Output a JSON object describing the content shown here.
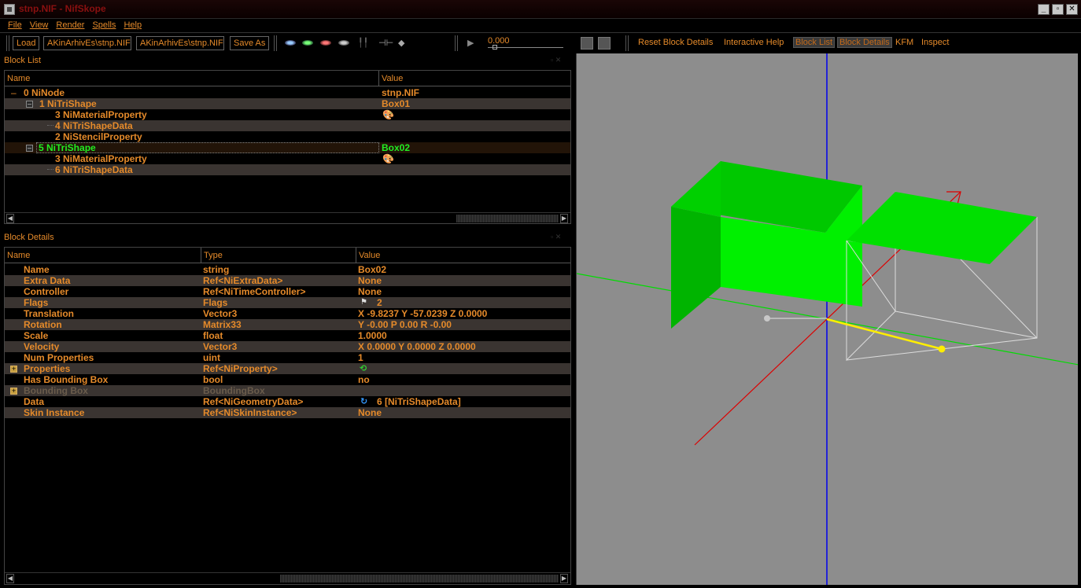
{
  "window": {
    "title": "stnp.NIF - NifSkope",
    "min": "_",
    "max": "▫",
    "close": "✕"
  },
  "menu": [
    "File",
    "View",
    "Render",
    "Spells",
    "Help"
  ],
  "toolbar": {
    "load": "Load",
    "path1": "AKinArhivEs\\stnp.NIF",
    "path2": "AKinArhivEs\\stnp.NIF",
    "save_as": "Save As",
    "time": "0.000",
    "reset_block_details": "Reset Block Details",
    "interactive_help": "Interactive Help",
    "block_list": "Block List",
    "block_details": "Block Details",
    "kfm": "KFM",
    "inspect": "Inspect"
  },
  "block_list": {
    "title": "Block List",
    "col_name": "Name",
    "col_value": "Value",
    "rows": [
      {
        "name": "0 NiNode",
        "value": "stnp.NIF"
      },
      {
        "name": "1 NiTriShape",
        "value": "Box01"
      },
      {
        "name": "3 NiMaterialProperty",
        "value": ""
      },
      {
        "name": "4 NiTriShapeData",
        "value": ""
      },
      {
        "name": "2 NiStencilProperty",
        "value": ""
      },
      {
        "name": "5 NiTriShape",
        "value": "Box02"
      },
      {
        "name": "3 NiMaterialProperty",
        "value": ""
      },
      {
        "name": "6 NiTriShapeData",
        "value": ""
      }
    ]
  },
  "block_details": {
    "title": "Block Details",
    "col_name": "Name",
    "col_type": "Type",
    "col_value": "Value",
    "rows": [
      {
        "name": "Name",
        "type": "string",
        "value": "Box02"
      },
      {
        "name": "Extra Data",
        "type": "Ref<NiExtraData>",
        "value": "None"
      },
      {
        "name": "Controller",
        "type": "Ref<NiTimeController>",
        "value": "None"
      },
      {
        "name": "Flags",
        "type": "Flags",
        "value": "2"
      },
      {
        "name": "Translation",
        "type": "Vector3",
        "value": "X -9.8237 Y -57.0239 Z 0.0000"
      },
      {
        "name": "Rotation",
        "type": "Matrix33",
        "value": "Y -0.00 P 0.00 R -0.00"
      },
      {
        "name": "Scale",
        "type": "float",
        "value": "1.0000"
      },
      {
        "name": "Velocity",
        "type": "Vector3",
        "value": "X 0.0000 Y 0.0000 Z 0.0000"
      },
      {
        "name": "Num Properties",
        "type": "uint",
        "value": "1"
      },
      {
        "name": "Properties",
        "type": "Ref<NiProperty>",
        "value": ""
      },
      {
        "name": "Has Bounding Box",
        "type": "bool",
        "value": "no"
      },
      {
        "name": "Bounding Box",
        "type": "BoundingBox",
        "value": ""
      },
      {
        "name": "Data",
        "type": "Ref<NiGeometryData>",
        "value": "6 [NiTriShapeData]"
      },
      {
        "name": "Skin Instance",
        "type": "Ref<NiSkinInstance>",
        "value": "None"
      }
    ]
  },
  "colors": {
    "text": "#e58a2a",
    "selected_text": "#22ee22",
    "alt_row": "#3a3431",
    "viewport_bg": "#8d8d8d",
    "mesh": "#00ee00"
  }
}
